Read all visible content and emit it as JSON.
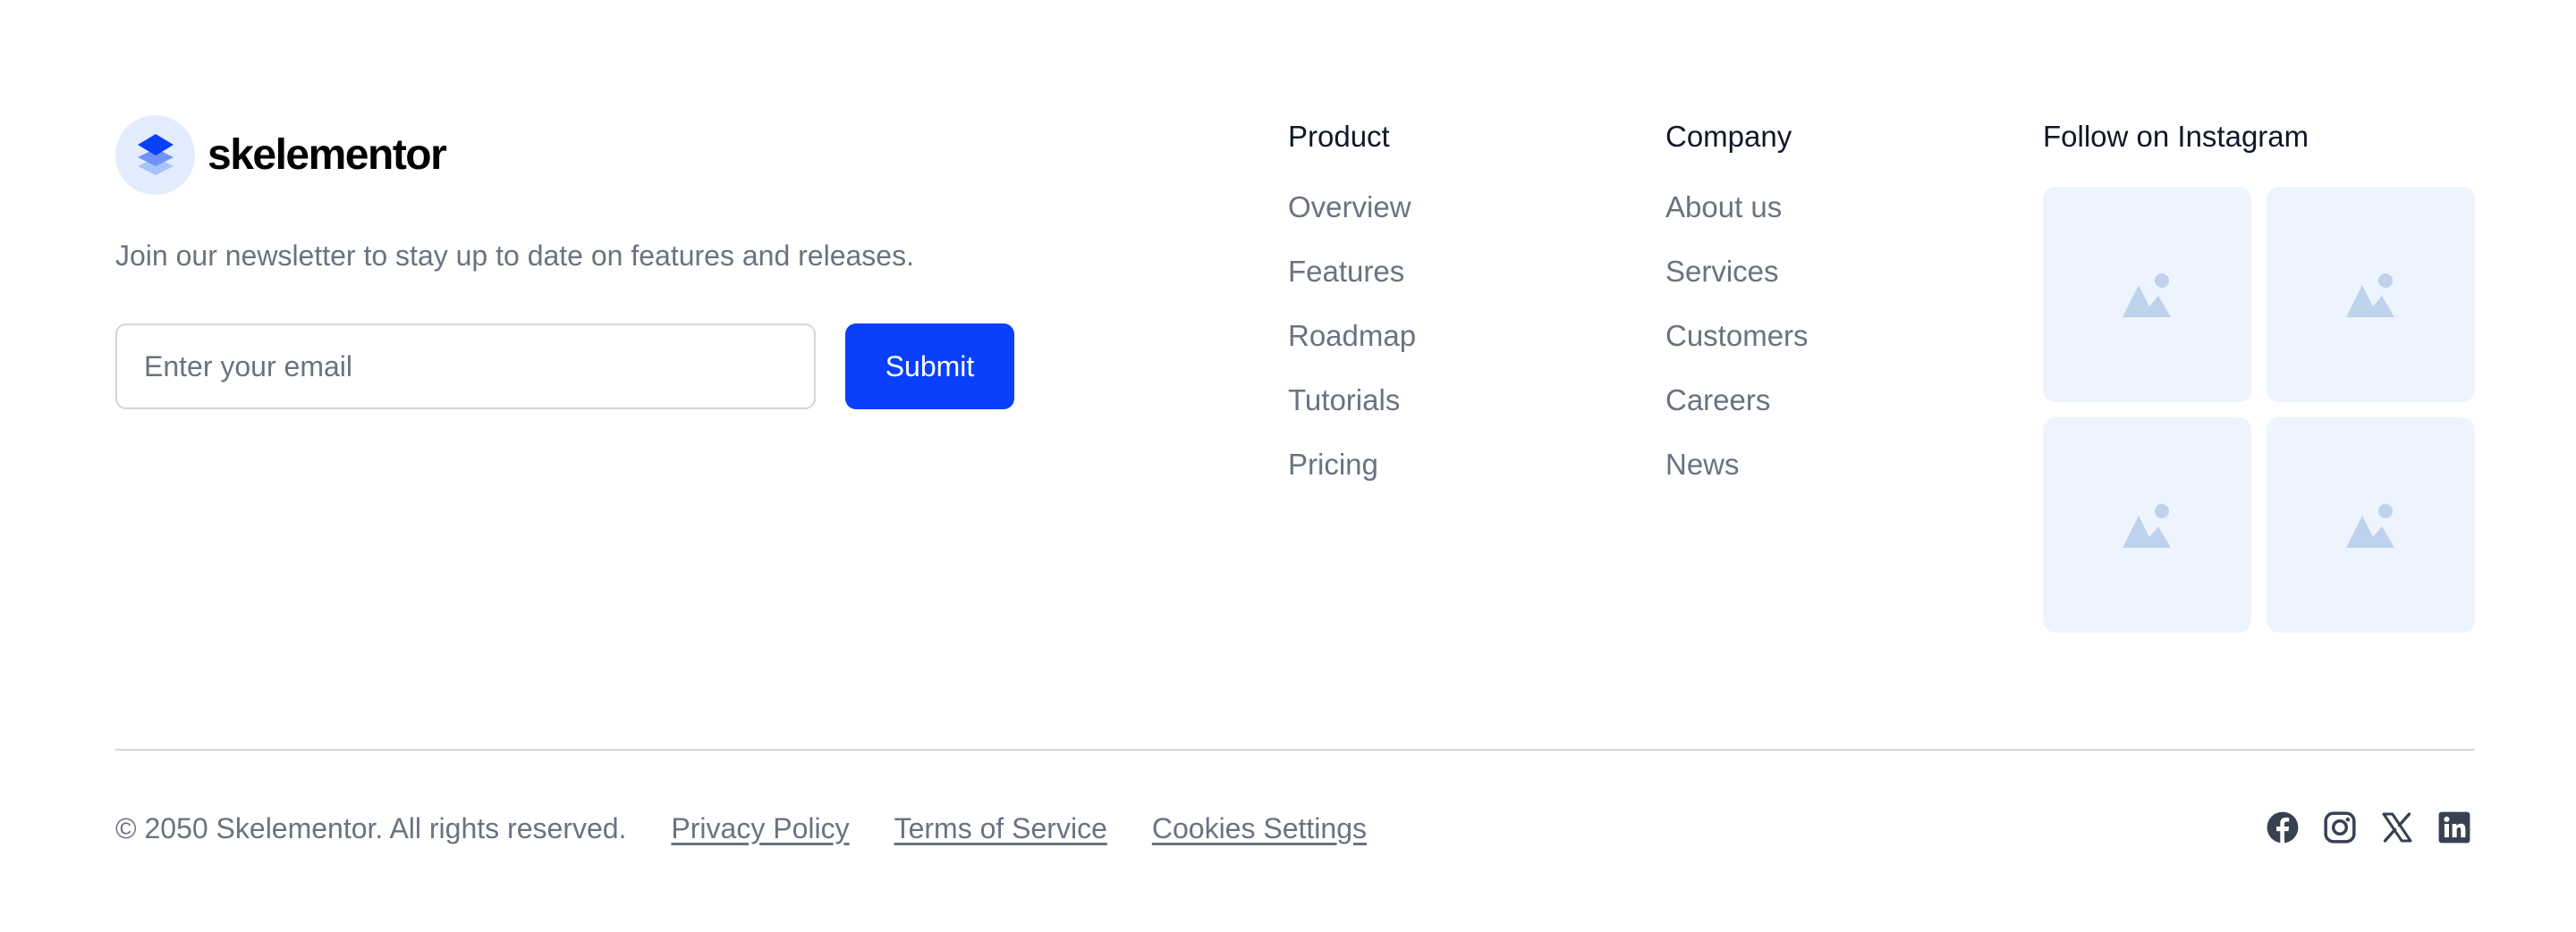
{
  "brand": {
    "name": "skelementor",
    "logo_icon": "layers-icon"
  },
  "newsletter": {
    "text": "Join our newsletter to stay up to date on features and releases.",
    "email_placeholder": "Enter your email",
    "email_value": "",
    "submit_label": "Submit"
  },
  "product": {
    "heading": "Product",
    "links": [
      "Overview",
      "Features",
      "Roadmap",
      "Tutorials",
      "Pricing"
    ]
  },
  "company": {
    "heading": "Company",
    "links": [
      "About us",
      "Services",
      "Customers",
      "Careers",
      "News"
    ]
  },
  "instagram": {
    "heading": "Follow on Instagram",
    "tile_icon": "image-placeholder-icon"
  },
  "bottom": {
    "copyright": "© 2050 Skelementor. All rights reserved.",
    "legal_links": [
      "Privacy Policy",
      "Terms of Service",
      "Cookies Settings"
    ]
  },
  "socials": [
    "facebook-icon",
    "instagram-icon",
    "x-icon",
    "linkedin-icon"
  ],
  "colors": {
    "accent": "#0a3ffb",
    "logo_bg": "#e3ecfd",
    "tile_bg": "#edf4fe",
    "tile_icon": "#bfd2ec",
    "muted_text": "#6b7280",
    "social_icon": "#374151"
  }
}
